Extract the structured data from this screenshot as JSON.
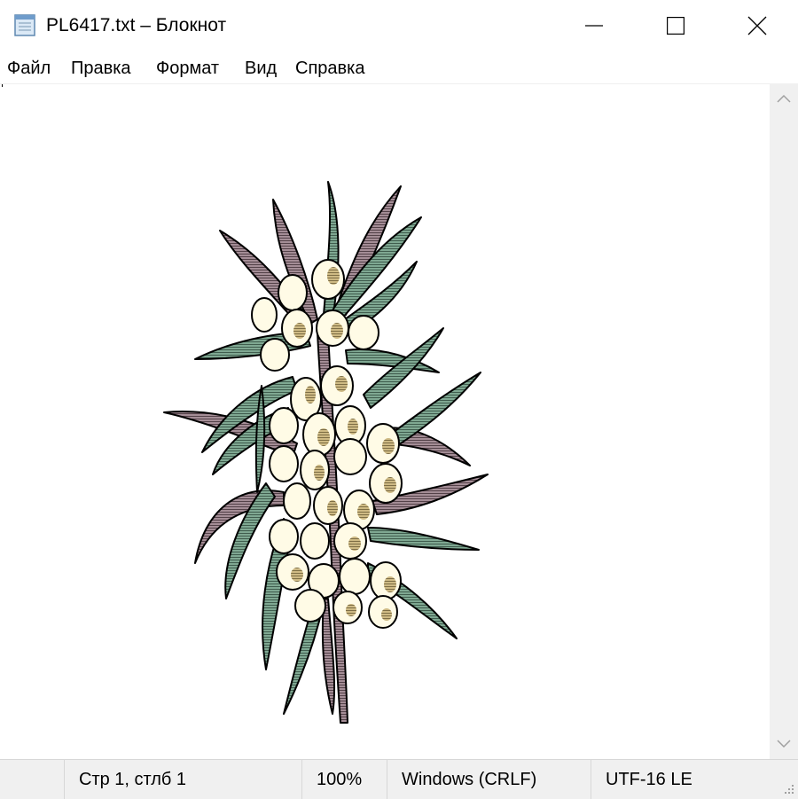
{
  "window": {
    "title": "PL6417.txt – Блокнот",
    "app_icon": "notepad-icon",
    "controls": [
      "minimize-icon",
      "maximize-icon",
      "close-icon"
    ]
  },
  "menu": {
    "items": [
      "Файл",
      "Правка",
      "Формат",
      "Вид",
      "Справка"
    ]
  },
  "content": {
    "illustration": "sea-buckthorn-branch"
  },
  "statusbar": {
    "position": "Стр 1, стлб 1",
    "zoom": "100%",
    "line_endings": "Windows (CRLF)",
    "encoding": "UTF-16 LE"
  },
  "colors": {
    "leaf_green": "#7fa892",
    "leaf_mauve": "#a48d96",
    "berry": "#fffbe6",
    "berry_shade": "#b8a16b",
    "outline": "#000000",
    "chrome": "#f0f0f0"
  }
}
